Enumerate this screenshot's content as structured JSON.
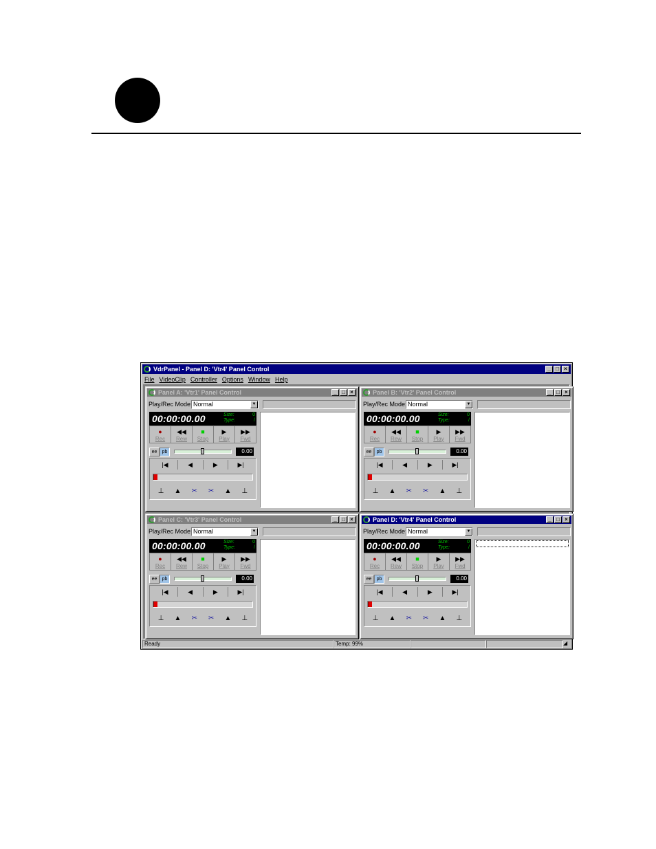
{
  "app": {
    "title": "VdrPanel - Panel D: 'Vtr4' Panel Control",
    "window_buttons": {
      "min": "_",
      "max": "□",
      "close": "×"
    },
    "menu": [
      "File",
      "VideoClip",
      "Controller",
      "Options",
      "Window",
      "Help"
    ]
  },
  "common": {
    "mode_label": "Play/Rec Mode:",
    "mode_value": "Normal",
    "timecode": "00:00:00.00",
    "size_label": "Size:",
    "type_label": "Type:",
    "size_value": "0",
    "type_value": "/",
    "ee_label": "ee",
    "pb_label": "pb",
    "speed": "0.00",
    "labels": {
      "rec": "Rec",
      "rew": "Rew",
      "stop": "Stop",
      "play": "Play",
      "fwd": "Fwd"
    }
  },
  "panels": [
    {
      "title": "Panel A: 'Vtr1' Panel Control",
      "active": false
    },
    {
      "title": "Panel B: 'Vtr2' Panel Control",
      "active": false
    },
    {
      "title": "Panel C: 'Vtr3' Panel Control",
      "active": false
    },
    {
      "title": "Panel D: 'Vtr4' Panel Control",
      "active": true
    }
  ],
  "icons": {
    "rec": "record-icon",
    "rew": "rewind-icon",
    "stop": "stop-icon",
    "play": "play-icon",
    "fwd": "fast-forward-icon"
  },
  "colors": {
    "title_active": "#000080",
    "title_inactive": "#808080",
    "rec": "#a00000",
    "stop": "#00d000",
    "timecode_info": "#00c000"
  },
  "statusbar": {
    "ready": "Ready",
    "temp": "Temp: 99%"
  }
}
